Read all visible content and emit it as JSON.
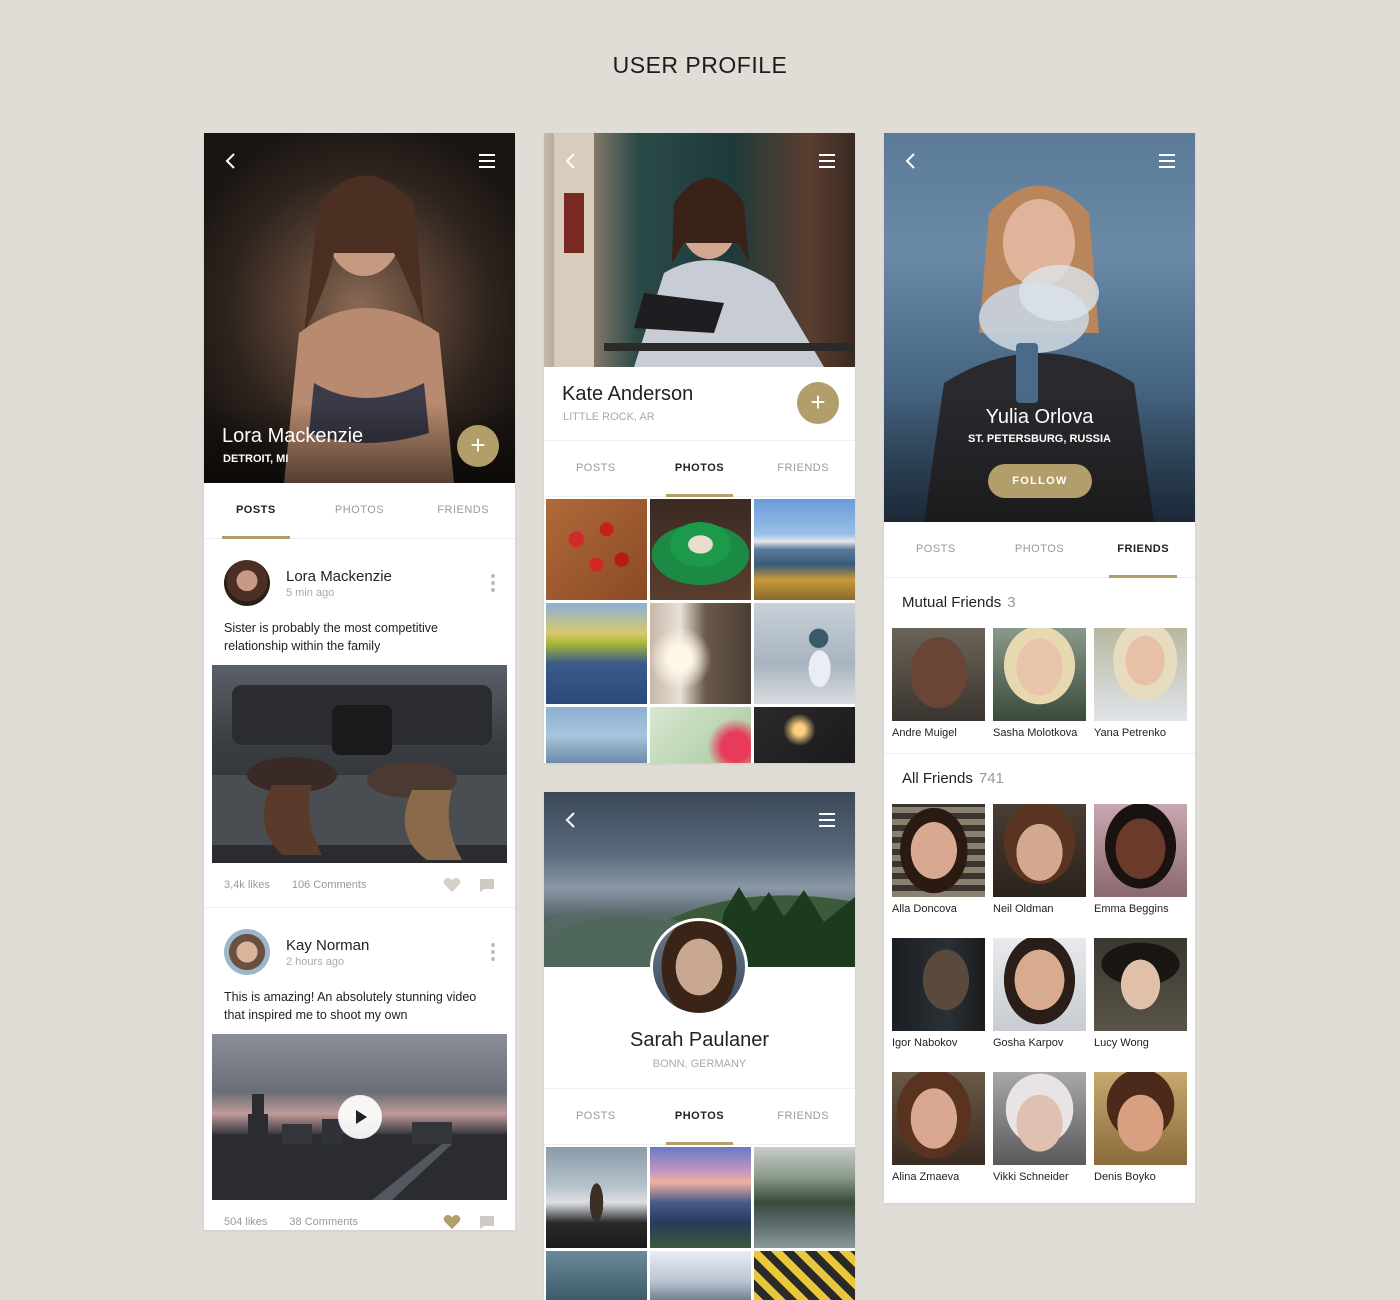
{
  "page_title": "USER PROFILE",
  "colors": {
    "accent": "#b29e6b",
    "background": "#e0ddd7"
  },
  "icons": [
    "chevron-left-icon",
    "menu-icon",
    "plus-icon",
    "more-vertical-icon",
    "heart-icon",
    "comment-icon",
    "play-icon"
  ],
  "profile1": {
    "name": "Lora Mackenzie",
    "location": "DETROIT, MI",
    "fab": "+",
    "tabs": [
      "POSTS",
      "PHOTOS",
      "FRIENDS"
    ],
    "active_tab": "POSTS",
    "posts": [
      {
        "author": "Lora Mackenzie",
        "time": "5 min ago",
        "text": "Sister is probably the most competitive relationship within the family",
        "likes": "3,4k likes",
        "comments": "106 Comments"
      },
      {
        "author": "Kay Norman",
        "time": "2 hours ago",
        "text": "This is amazing! An absolutely stunning video that inspired me to shoot my own",
        "likes": "504 likes",
        "comments": "38 Comments"
      }
    ]
  },
  "profile2": {
    "name": "Kate Anderson",
    "location": "LITTLE ROCK, AR",
    "fab": "+",
    "tabs": [
      "POSTS",
      "PHOTOS",
      "FRIENDS"
    ],
    "active_tab": "PHOTOS"
  },
  "profile3": {
    "name": "Sarah Paulaner",
    "location": "BONN, GERMANY",
    "tabs": [
      "POSTS",
      "PHOTOS",
      "FRIENDS"
    ],
    "active_tab": "PHOTOS"
  },
  "profile4": {
    "name": "Yulia Orlova",
    "location": "ST. PETERSBURG, RUSSIA",
    "follow_label": "FOLLOW",
    "tabs": [
      "POSTS",
      "PHOTOS",
      "FRIENDS"
    ],
    "active_tab": "FRIENDS",
    "mutual_label": "Mutual Friends",
    "mutual_count": "3",
    "mutual": [
      "Andre Muigel",
      "Sasha Molotkova",
      "Yana Petrenko"
    ],
    "all_label": "All Friends",
    "all_count": "741",
    "all": [
      "Alla Doncova",
      "Neil Oldman",
      "Emma Beggins",
      "Igor Nabokov",
      "Gosha Karpov",
      "Lucy Wong",
      "Alina Zmaeva",
      "Vikki Schneider",
      "Denis Boyko"
    ]
  }
}
